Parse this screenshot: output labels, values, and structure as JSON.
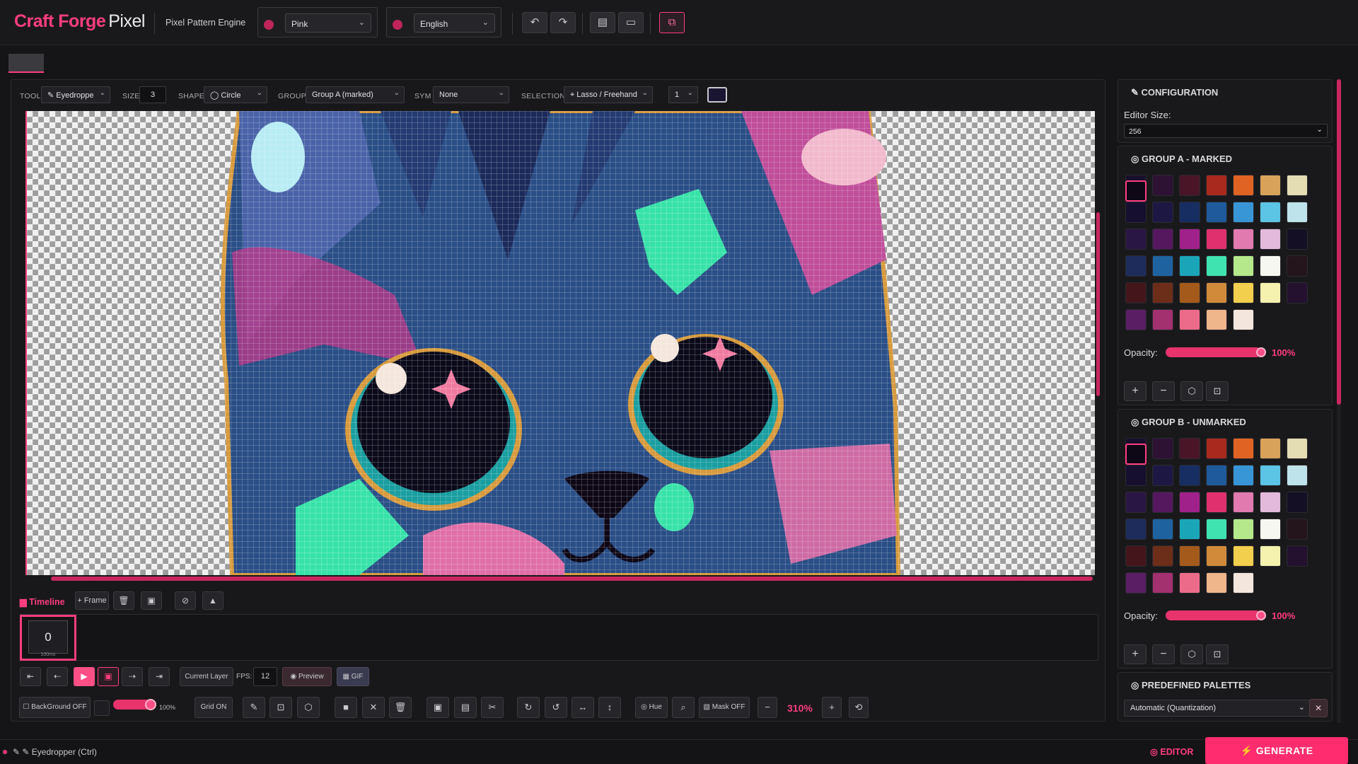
{
  "header": {
    "brand_main": "Craft Forge",
    "brand_sub": "Pixel",
    "subtitle": "Pixel Pattern Engine",
    "theme_select": "Pink",
    "language_select": "English"
  },
  "toolbar": {
    "tool_label": "TOOL",
    "tool_value": "Eyedroppe",
    "size_label": "SIZE",
    "size_value": "3",
    "shape_label": "SHAPE",
    "shape_value": "Circle",
    "group_label": "GROUP",
    "group_value": "Group A (marked)",
    "sym_label": "SYM",
    "sym_value": "None",
    "selection_label": "SELECTION",
    "selection_value": "Lasso / Freehand",
    "layer_value": "1"
  },
  "timeline": {
    "title": "Timeline",
    "add_frame": "+ Frame",
    "frame_index": "0",
    "frame_duration": "100ms",
    "current_layer": "Current Layer",
    "fps_label": "FPS:",
    "fps_value": "12",
    "preview": "Preview",
    "gif": "GIF"
  },
  "bottom_tools": {
    "background": "BackGround OFF",
    "bg_opacity": "100%",
    "grid": "Grid ON",
    "hue": "Hue",
    "mask": "Mask OFF",
    "zoom": "310%"
  },
  "config": {
    "title": "CONFIGURATION",
    "editor_size_label": "Editor Size:",
    "editor_size_value": "256"
  },
  "group_a": {
    "title": "GROUP A - MARKED",
    "opacity_label": "Opacity:",
    "opacity_value": "100%",
    "opacity": 1.0
  },
  "group_b": {
    "title": "GROUP B - UNMARKED",
    "opacity_label": "Opacity:",
    "opacity_value": "100%",
    "opacity": 1.0
  },
  "predefined": {
    "title": "PREDEFINED PALETTES",
    "select_value": "Automatic (Quantization)"
  },
  "palette": [
    "#0d0716",
    "#170f2b",
    "#2d1234",
    "#4a1526",
    "#a9291e",
    "#e06324",
    "#d9a25b",
    "#e4ddb4",
    "#160f2f",
    "#1d1843",
    "#172e62",
    "#1f5a9c",
    "#3896d6",
    "#5cc4e4",
    "#bfe3ea",
    "#2a1645",
    "#55185f",
    "#a0218a",
    "#e0316e",
    "#e07aaf",
    "#e3b9dc",
    "#140f25",
    "#1e2c5c",
    "#1e63a0",
    "#1aa6b8",
    "#3fe3b0",
    "#b5e88a",
    "#f7f7f2",
    "#24141c",
    "#44161c",
    "#6c2d19",
    "#a45a1a",
    "#d08a3a",
    "#f2cf4c",
    "#f5f2b0",
    "#24112f",
    "#5a1e64",
    "#a3306f",
    "#ed6b8a",
    "#efb58b",
    "#f4e6dc"
  ],
  "status": {
    "tool_hint": "Eyedropper (Ctrl)",
    "editor": "EDITOR",
    "generate": "GENERATE"
  },
  "colors": {
    "accent": "#ff3d7f",
    "background": "#151517"
  }
}
